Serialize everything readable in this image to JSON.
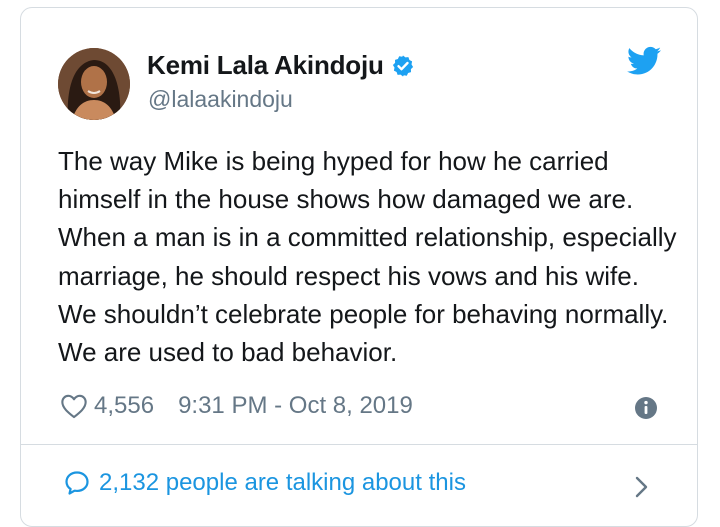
{
  "tweet": {
    "display_name": "Kemi Lala Akindoju",
    "handle": "@lalaakindoju",
    "text": "The way Mike is being hyped for how he carried himself in the house shows how damaged we are. When a man is in a committed relationship, especially marriage, he should respect his vows and his wife. We shouldn’t celebrate people for behaving normally. We are used to bad behavior.",
    "likes": "4,556",
    "timestamp": "9:31 PM - Oct 8, 2019",
    "talking": "2,132 people are talking about this"
  },
  "icons": {
    "verified": "verified-badge-icon",
    "brand": "twitter-bird-icon",
    "like": "heart-icon",
    "info": "info-icon",
    "comment": "speech-bubble-icon",
    "chevron": "chevron-right-icon"
  },
  "colors": {
    "brand_blue": "#1da1f2",
    "link_blue": "#1b95e0",
    "secondary_text": "#657786",
    "primary_text": "#14171a",
    "border": "#d6dce1"
  }
}
